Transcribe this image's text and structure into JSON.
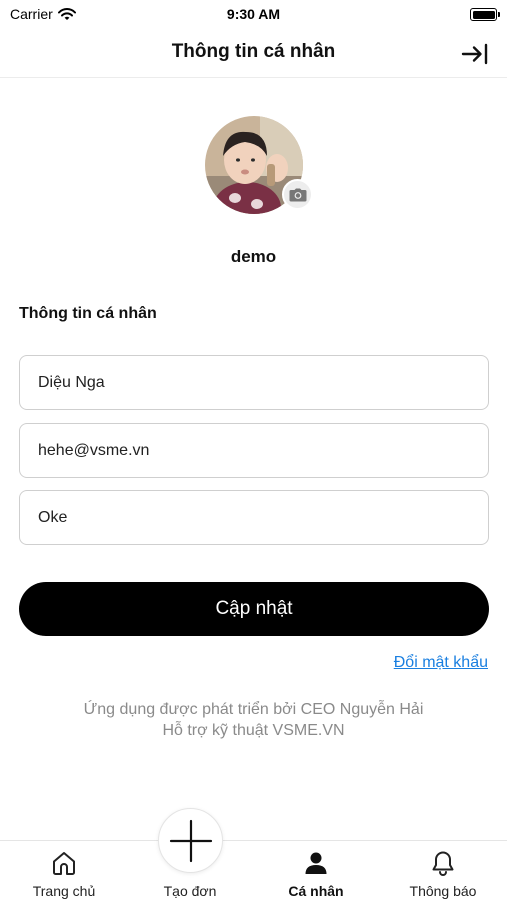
{
  "status_bar": {
    "carrier": "Carrier",
    "time": "9:30 AM"
  },
  "header": {
    "title": "Thông tin cá nhân",
    "action_icon": "logout-icon"
  },
  "profile": {
    "avatar_icon": "camera-icon",
    "username": "demo"
  },
  "form": {
    "section_title": "Thông tin cá nhân",
    "name_value": "Diệu Nga",
    "email_value": "hehe@vsme.vn",
    "note_value": "Oke"
  },
  "actions": {
    "update_label": "Cập nhật",
    "change_password_label": "Đổi mật khẩu"
  },
  "footer": {
    "credit_line1": "Ứng dụng được phát triển bởi CEO Nguyễn Hải",
    "credit_line2": "Hỗ trợ kỹ thuật VSME.VN"
  },
  "tabbar": {
    "active": "Cá nhân",
    "items": [
      {
        "label": "Trang chủ",
        "icon": "home-icon"
      },
      {
        "label": "Tạo đơn",
        "icon": "plus-icon"
      },
      {
        "label": "Cá nhân",
        "icon": "person-icon"
      },
      {
        "label": "Thông báo",
        "icon": "bell-icon"
      }
    ]
  },
  "colors": {
    "primary": "#000000",
    "link": "#1a7fe0",
    "muted_text": "#8a8a8a",
    "field_border": "#cfcfcf"
  }
}
